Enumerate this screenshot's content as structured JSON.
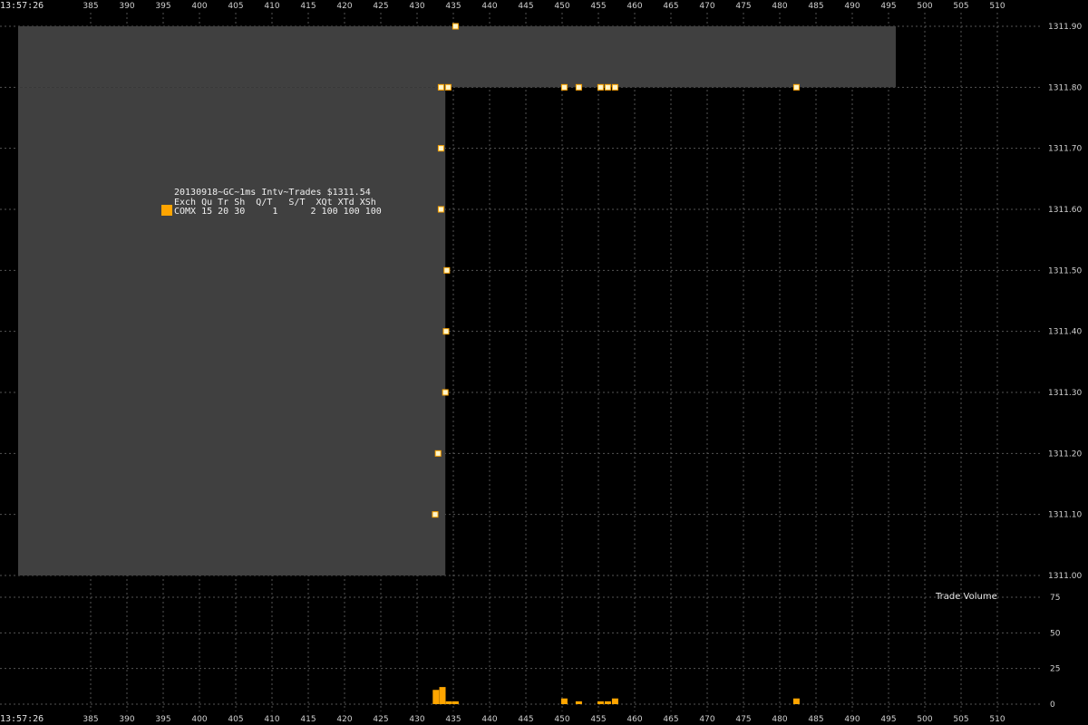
{
  "chart_data": {
    "type": "scatter",
    "legend": {
      "title": "20130918~GC~1ms Intv~Trades $1311.54",
      "header": "Exch Qu Tr Sh  Q/T   S/T  XQt XTd XSh",
      "row": "COMX 15 20 30     1      2 100 100 100",
      "swatch_color": "#ffa500"
    },
    "time_label": "13:57:26",
    "x_ticks": [
      "385",
      "390",
      "395",
      "400",
      "405",
      "410",
      "415",
      "420",
      "425",
      "430",
      "435",
      "440",
      "445",
      "450",
      "455",
      "460",
      "465",
      "470",
      "475",
      "480",
      "485",
      "490",
      "495",
      "500",
      "505",
      "510"
    ],
    "y_ticks": [
      "1311.90",
      "1311.80",
      "1311.70",
      "1311.60",
      "1311.50",
      "1311.40",
      "1311.30",
      "1311.20",
      "1311.10",
      "1311.00"
    ],
    "xlim": [
      380,
      515
    ],
    "ylim": [
      1311.0,
      1311.9
    ],
    "price_points": [
      {
        "x": 435.3,
        "y": 1311.9
      },
      {
        "x": 433.3,
        "y": 1311.8
      },
      {
        "x": 434.3,
        "y": 1311.8
      },
      {
        "x": 450.3,
        "y": 1311.8
      },
      {
        "x": 452.3,
        "y": 1311.8
      },
      {
        "x": 455.3,
        "y": 1311.8
      },
      {
        "x": 456.3,
        "y": 1311.8
      },
      {
        "x": 457.3,
        "y": 1311.8
      },
      {
        "x": 482.3,
        "y": 1311.8
      },
      {
        "x": 433.3,
        "y": 1311.7
      },
      {
        "x": 433.3,
        "y": 1311.6
      },
      {
        "x": 434.1,
        "y": 1311.5
      },
      {
        "x": 434.0,
        "y": 1311.4
      },
      {
        "x": 433.9,
        "y": 1311.3
      },
      {
        "x": 432.9,
        "y": 1311.2
      },
      {
        "x": 432.5,
        "y": 1311.1
      }
    ],
    "bid_area": {
      "x_end": 433.9,
      "y_top": 1311.8,
      "y_bottom": 1311.0,
      "color": "#404040"
    },
    "ask_area": {
      "x_end": 496.0,
      "y_top": 1311.9,
      "y_bottom": 1311.8,
      "color": "#404040"
    },
    "volume": {
      "label": "Trade Volume",
      "y_ticks": [
        "75",
        "50",
        "25",
        "0"
      ],
      "ylim": [
        0,
        75
      ],
      "color": "#ffa500",
      "bars": [
        {
          "x": 432.6,
          "v": 10
        },
        {
          "x": 433.5,
          "v": 12
        },
        {
          "x": 434.4,
          "v": 2
        },
        {
          "x": 435.3,
          "v": 2
        },
        {
          "x": 450.3,
          "v": 4
        },
        {
          "x": 452.3,
          "v": 2
        },
        {
          "x": 455.3,
          "v": 2
        },
        {
          "x": 456.3,
          "v": 2
        },
        {
          "x": 457.3,
          "v": 4
        },
        {
          "x": 482.3,
          "v": 4
        }
      ]
    },
    "grid": true
  }
}
